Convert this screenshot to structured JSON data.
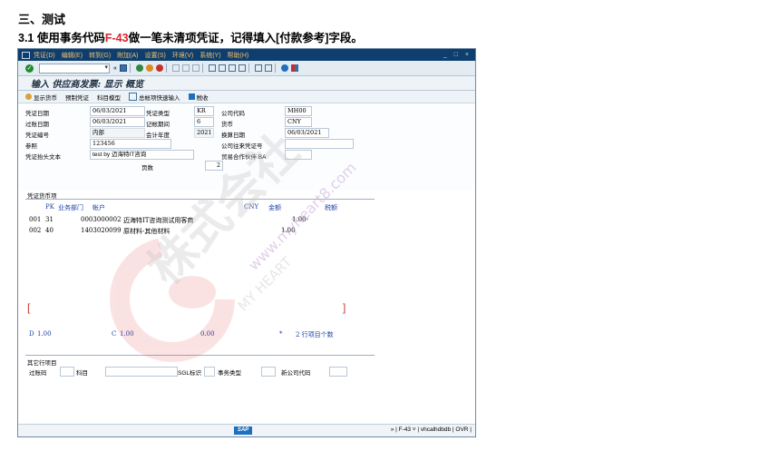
{
  "doc": {
    "heading": "三、测试",
    "para_prefix": "3.1 使用事务代码",
    "para_code": "F-43",
    "para_suffix": "做一笔未清项凭证，记得填入[付款参考]字段。"
  },
  "menu": [
    "凭证(D)",
    "编辑(E)",
    "转到(G)",
    "附加(A)",
    "设置(S)",
    "环境(V)",
    "系统(Y)",
    "帮助(H)"
  ],
  "window_controls": "_ □ ×",
  "title": "输入 供应商发票: 显示 概览",
  "app_toolbar": [
    "显示货币",
    "预制凭证",
    "科目模型",
    "总帐项快速输入",
    "税收"
  ],
  "header": {
    "doc_date_label": "凭证日期",
    "doc_date": "06/03/2021",
    "doc_type_label": "凭证类型",
    "doc_type": "KR",
    "company_code_label": "公司代码",
    "company_code": "MH00",
    "posting_date_label": "过账日期",
    "posting_date": "06/03/2021",
    "period_label": "记帐期间",
    "period": "6",
    "currency_label": "货币",
    "currency": "CNY",
    "doc_number_label": "凭证编号",
    "doc_number": "内部",
    "fiscal_year_label": "会计年度",
    "fiscal_year": "2021",
    "translation_date_label": "换算日期",
    "translation_date": "06/03/2021",
    "reference_label": "参照",
    "reference": "123456",
    "cross_cc_label": "公司往来凭证号",
    "cross_cc": "",
    "header_text_label": "凭证抬头文本",
    "header_text": "test by 迈海特IT咨询",
    "trading_partner_label": "贸易合作伙伴 BA",
    "trading_partner": "",
    "pages_label": "页数",
    "pages": "2"
  },
  "items": {
    "section_title": "凭证货币项",
    "columns": {
      "pk": "PK",
      "bus_area": "业务部门",
      "account": "帐户",
      "currency": "CNY",
      "amount": "金额",
      "tax": "税额"
    },
    "rows": [
      {
        "no": "001",
        "pk": "31",
        "account": "0003000002",
        "text": "迈海特IT咨询测试用客商",
        "amount": "1.00-"
      },
      {
        "no": "002",
        "pk": "40",
        "account": "1403020099",
        "text": "原材料-其他材料",
        "amount": "1.00"
      }
    ],
    "totals": {
      "debit_label": "D",
      "debit": "1.00",
      "credit_label": "C",
      "credit": "1.00",
      "balance": "0.00",
      "star": "*",
      "count_text": "2 行项目个数"
    }
  },
  "other": {
    "title": "其它行项目",
    "fields": [
      "过账码",
      "科目",
      "SGL标识",
      "事务类型",
      "新公司代码"
    ]
  },
  "status": {
    "sap": "SAP",
    "right": "» | F-43 ˅ | vhcalhdbdb | OVR |"
  },
  "watermark": {
    "cn": "株式会社",
    "url": "www.myheart8.com",
    "en": "MY HEART"
  },
  "colors": {
    "menubar": "#0d3e6e",
    "accent_red": "#d9232d",
    "label_blue": "#1e3fa8"
  }
}
